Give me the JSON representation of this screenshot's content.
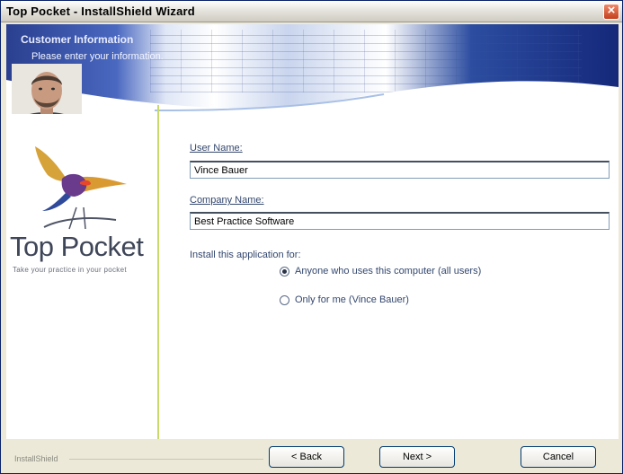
{
  "window": {
    "title": "Top Pocket - InstallShield Wizard"
  },
  "banner": {
    "title": "Customer Information",
    "subtitle": "Please enter your information."
  },
  "logo": {
    "name": "Top Pocket",
    "tagline": "Take your practice in your pocket"
  },
  "form": {
    "user_name_label": "User Name:",
    "user_name_value": "Vince Bauer",
    "company_name_label": "Company Name:",
    "company_name_value": "Best Practice Software",
    "install_for_label": "Install this application for:",
    "options": [
      {
        "label": "Anyone who uses this computer (all users)",
        "selected": true
      },
      {
        "label": "Only for me (Vince Bauer)",
        "selected": false
      }
    ]
  },
  "footer": {
    "brand": "InstallShield",
    "back_label": "< Back",
    "next_label": "Next >",
    "cancel_label": "Cancel"
  },
  "icons": [
    "close-icon",
    "person-photo",
    "bird-logo-icon",
    "radio-selected-icon",
    "radio-unselected-icon"
  ],
  "colors": {
    "title_bar": "#e6e4de",
    "label_text": "#33476e",
    "divider_accent": "#c9d96a",
    "button_border": "#003c74",
    "close_button": "#c4401d"
  }
}
